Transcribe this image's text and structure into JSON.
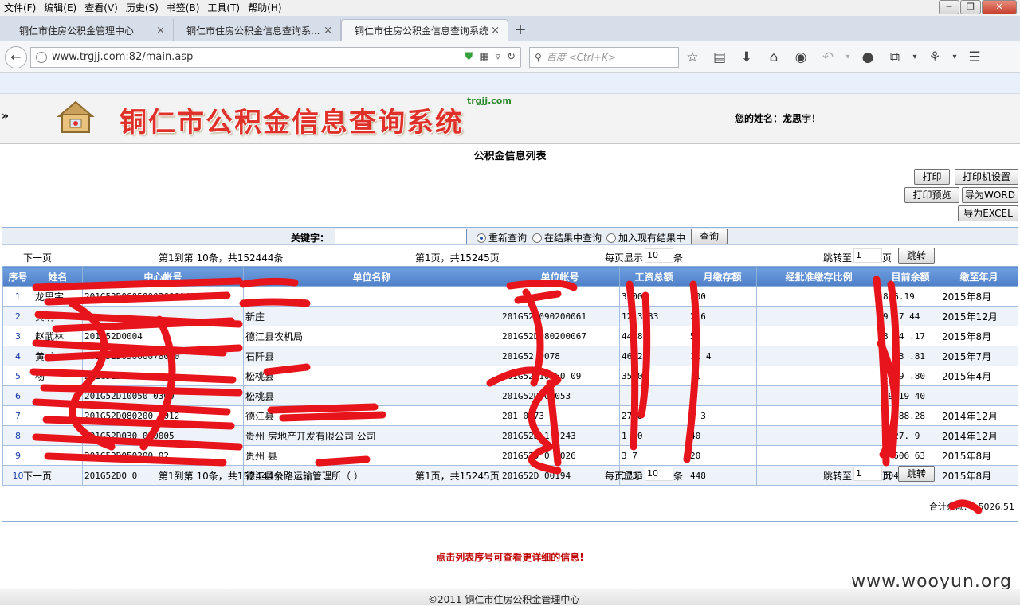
{
  "menubar": {
    "items": [
      "文件(F)",
      "编辑(E)",
      "查看(V)",
      "历史(S)",
      "书签(B)",
      "工具(T)",
      "帮助(H)"
    ],
    "minimize": "─",
    "restore": "❐",
    "close": "✕"
  },
  "tabs": [
    {
      "title": "铜仁市住房公积金管理中心"
    },
    {
      "title": "铜仁市住房公积金信息查询系..."
    },
    {
      "title": "铜仁市住房公积金信息查询系统"
    }
  ],
  "tab_close": "×",
  "new_tab": "+",
  "nav": {
    "url": "www.trgjj.com:82/main.asp",
    "search_placeholder": "百度 <Ctrl+K>",
    "back_glyph": "←",
    "reload_glyph": "↻",
    "search_glyph": "🔍",
    "icons": [
      "star-icon",
      "reader-icon",
      "download-icon",
      "home-icon",
      "chat-icon",
      "undo-icon",
      "comment-icon",
      "crop-icon",
      "puzzle-icon",
      "menu-icon"
    ]
  },
  "site": {
    "name": "铜仁市公积金信息查询系统",
    "domain": "trgjj.com",
    "user_label": "您的姓名：龙思宇！",
    "arrows": "»"
  },
  "list": {
    "title": "公积金信息列表",
    "buttons": {
      "print": "打印",
      "printer_setup": "打印机设置",
      "preview": "打印预览",
      "word": "导为WORD",
      "excel": "导为EXCEL",
      "query": "查询",
      "jump": "跳转"
    },
    "search": {
      "label": "关键字：",
      "value": "",
      "options": [
        "重新查询",
        "在结果中查询",
        "加入现有结果中"
      ],
      "selected": "重新查询"
    },
    "pager": {
      "next": "下一页",
      "range": "第1到第  10条，共152444条",
      "page": "第1页，共15245页",
      "per_page_prefix": "每页显示",
      "per_page_value": "10",
      "per_page_suffix": "条",
      "jump_prefix": "跳转至",
      "jump_value": "1",
      "jump_suffix": "页"
    },
    "columns": [
      "序号",
      "姓名",
      "中心帐号",
      "单位名称",
      "单位帐号",
      "工资总额",
      "月缴存额",
      "经批准缴存比例",
      "目前余额",
      "缴至年月"
    ],
    "rows": [
      [
        "1",
        "龙思宇",
        "201G52D060500036000437",
        "",
        "",
        "3300",
        "300",
        "",
        "8 6.19",
        "2015年8月"
      ],
      [
        "2",
        "黄明",
        "",
        "新庄",
        "201G52D090200061",
        "12 3.33",
        "2 6",
        "",
        "9 17 44",
        "2015年12月"
      ],
      [
        "3",
        "赵武林",
        "201G52D0004",
        "德江县农机局",
        "201G52D080200067",
        "44 8",
        "53",
        "",
        "8 04 .17",
        "2015年8月"
      ],
      [
        "4",
        "黄书",
        "201G52D05000078000",
        "石阡县",
        "201G52 0078",
        "46 2",
        "11 4",
        "",
        "4 73 .81",
        "2015年7月"
      ],
      [
        "5",
        "杨",
        "201G52D100 4",
        "松桃县",
        "201G52D10050 09",
        "35 0",
        "71",
        "",
        "19 9 .80",
        "2015年4月"
      ],
      [
        "6",
        "",
        "201G52D10050 0300",
        "松桃县",
        "201G52D 0 053",
        "",
        "",
        "",
        "49 19 40",
        ""
      ],
      [
        "7",
        "",
        "201G52D080200 0012",
        "德江县",
        "201 0473",
        "27 8",
        "2 3",
        "",
        "2 688.28",
        "2014年12月"
      ],
      [
        "8",
        "",
        "201G52D030 000005",
        "贵州 房地产开发有限公司 公司",
        "201G52D 1 0243",
        "1 00",
        "40",
        "",
        "1927. 9",
        "2014年12月"
      ],
      [
        "9",
        "",
        "201G52D050200 02",
        "贵州 县 ",
        "201G52D 0 0026",
        "3 7",
        "20",
        "",
        "3 606 63",
        "2015年8月"
      ],
      [
        "10",
        "",
        "201G52D0 0",
        "德江县公路运输管理所（ ）",
        "201G52D 00194",
        "3733",
        "448",
        "",
        "50418.52",
        "2015年8月"
      ]
    ],
    "total": "合计余额: 4     5026.51",
    "notice": "点击列表序号可查看更详细的信息!"
  },
  "footer": {
    "copyright": "©2011 铜仁市住房公积金管理中心"
  },
  "watermark": "www.wooyun.org",
  "colors": {
    "header_title": "#e0302a",
    "table_header": "#5a8bd2",
    "notice": "#c00000",
    "redaction": "#e8141c"
  }
}
